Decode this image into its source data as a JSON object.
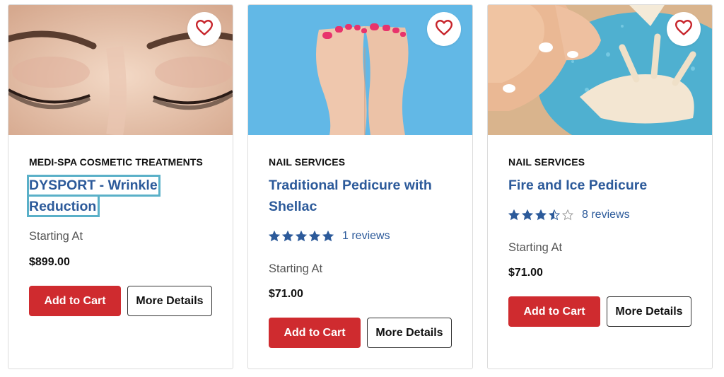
{
  "products": [
    {
      "category": "MEDI-SPA COSMETIC TREATMENTS",
      "title": "DYSPORT - Wrinkle Reduction",
      "starting_label": "Starting At",
      "price": "$899.00",
      "add_label": "Add to Cart",
      "more_label": "More Details",
      "image_icon": "closed-eyes-photo",
      "favorite_icon": "heart-icon"
    },
    {
      "category": "NAIL SERVICES",
      "title": "Traditional Pedicure with Shellac",
      "rating": 5,
      "reviews": "1 reviews",
      "starting_label": "Starting At",
      "price": "$71.00",
      "add_label": "Add to Cart",
      "more_label": "More Details",
      "image_icon": "pink-toenails-photo",
      "favorite_icon": "heart-icon"
    },
    {
      "category": "NAIL SERVICES",
      "title": "Fire and Ice Pedicure",
      "rating": 3.5,
      "reviews": "8 reviews",
      "starting_label": "Starting At",
      "price": "$71.00",
      "add_label": "Add to Cart",
      "more_label": "More Details",
      "image_icon": "feet-seashell-photo",
      "favorite_icon": "heart-icon"
    }
  ],
  "colors": {
    "accent_red": "#cf2b2f",
    "link_blue": "#2c5a9a",
    "focus_outline": "#5ab0c8",
    "heart": "#c7242b"
  }
}
